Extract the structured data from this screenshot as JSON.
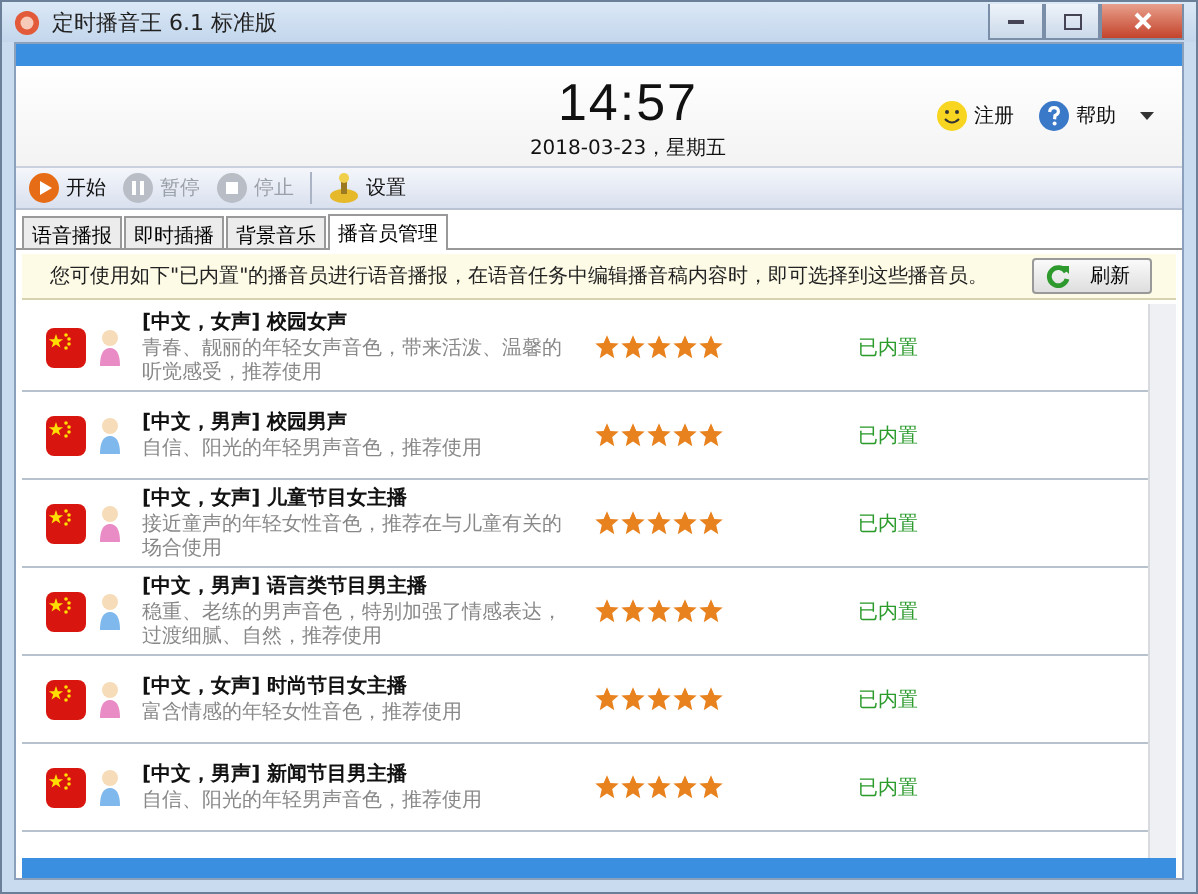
{
  "window": {
    "title": "定时播音王 6.1 标准版"
  },
  "clock": {
    "time": "14:57",
    "date": "2018-03-23，星期五"
  },
  "header_links": [
    {
      "label": "注册",
      "kind": "smile"
    },
    {
      "label": "帮助",
      "kind": "help"
    }
  ],
  "toolbar": [
    {
      "label": "开始",
      "kind": "play",
      "disabled": false
    },
    {
      "label": "暂停",
      "kind": "pause",
      "disabled": true
    },
    {
      "label": "停止",
      "kind": "stop",
      "disabled": true
    },
    {
      "label": "设置",
      "kind": "settings",
      "disabled": false
    }
  ],
  "tabs": [
    {
      "label": "语音播报",
      "selected": false
    },
    {
      "label": "即时插播",
      "selected": false
    },
    {
      "label": "背景音乐",
      "selected": false
    },
    {
      "label": "播音员管理",
      "selected": true
    }
  ],
  "info": {
    "text": "您可使用如下\"已内置\"的播音员进行语音播报，在语音任务中编辑播音稿内容时，即可选择到这些播音员。",
    "button": "刷新"
  },
  "voices": [
    {
      "title": "[中文，女声] 校园女声",
      "description": "青春、靓丽的年轻女声音色，带来活泼、温馨的听觉感受，推荐使用",
      "kind": "female",
      "stars": 5,
      "status": "已内置"
    },
    {
      "title": "[中文，男声] 校园男声",
      "description": "自信、阳光的年轻男声音色，推荐使用",
      "kind": "male",
      "stars": 5,
      "status": "已内置"
    },
    {
      "title": "[中文，女声] 儿童节目女主播",
      "description": "接近童声的年轻女性音色，推荐在与儿童有关的场合使用",
      "kind": "female",
      "stars": 5,
      "status": "已内置"
    },
    {
      "title": "[中文，男声] 语言类节目男主播",
      "description": "稳重、老练的男声音色，特别加强了情感表达，过渡细腻、自然，推荐使用",
      "kind": "male",
      "stars": 5,
      "status": "已内置"
    },
    {
      "title": "[中文，女声] 时尚节目女主播",
      "description": "富含情感的年轻女性音色，推荐使用",
      "kind": "female",
      "stars": 5,
      "status": "已内置"
    },
    {
      "title": "[中文，男声] 新闻节目男主播",
      "description": "自信、阳光的年轻男声音色，推荐使用",
      "kind": "male",
      "stars": 5,
      "status": "已内置"
    }
  ]
}
